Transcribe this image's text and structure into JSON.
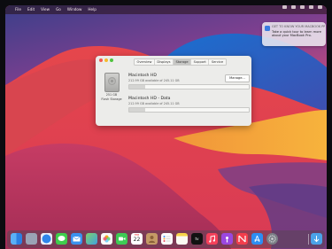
{
  "menu_bar": {
    "apple": "",
    "items": [
      "File",
      "Edit",
      "View",
      "Go",
      "Window",
      "Help"
    ]
  },
  "notification": {
    "title": "GET TO KNOW YOUR MACBOOK PRO",
    "body": "Take a quick tour to learn more about your MacBook Pro."
  },
  "about_window": {
    "tabs": [
      "Overview",
      "Displays",
      "Storage",
      "Support",
      "Service"
    ],
    "active_tab": "Storage",
    "disk_size": "251 GB",
    "disk_type": "Flash Storage",
    "volumes": [
      {
        "name": "Macintosh HD",
        "available": "212.99 GB available of 245.11 GB",
        "used_fraction": 0.13,
        "button": "Manage..."
      },
      {
        "name": "Macintosh HD - Data",
        "available": "212.99 GB available of 245.11 GB",
        "used_fraction": 0.13
      }
    ]
  },
  "dock": {
    "calendar_month": "FEB",
    "calendar_day": "22",
    "apps": [
      "finder",
      "launchpad",
      "safari",
      "messages",
      "mail",
      "maps",
      "photos",
      "facetime",
      "calendar",
      "contacts",
      "reminders",
      "notes",
      "apple-tv",
      "music",
      "podcasts",
      "news",
      "app-store",
      "system-preferences",
      "downloads",
      "trash"
    ]
  }
}
